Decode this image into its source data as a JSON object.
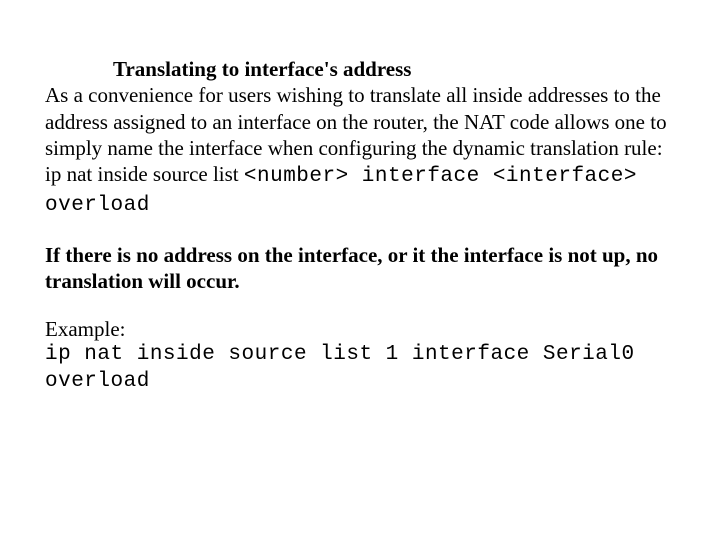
{
  "heading": "Translating to interface's address",
  "intro": "As a convenience for users wishing to translate all inside addresses to the address assigned to an interface on the router, the NAT code allows one to simply name the interface when configuring the dynamic translation rule:",
  "syntax_lead": "ip nat inside source list ",
  "syntax_code1": "<number> interface <interface> overload",
  "note": "If there is no address on the interface, or it the interface is not up, no translation will occur.",
  "example_label": "Example:",
  "example_code": "ip nat inside source list 1 interface Serial0 overload"
}
